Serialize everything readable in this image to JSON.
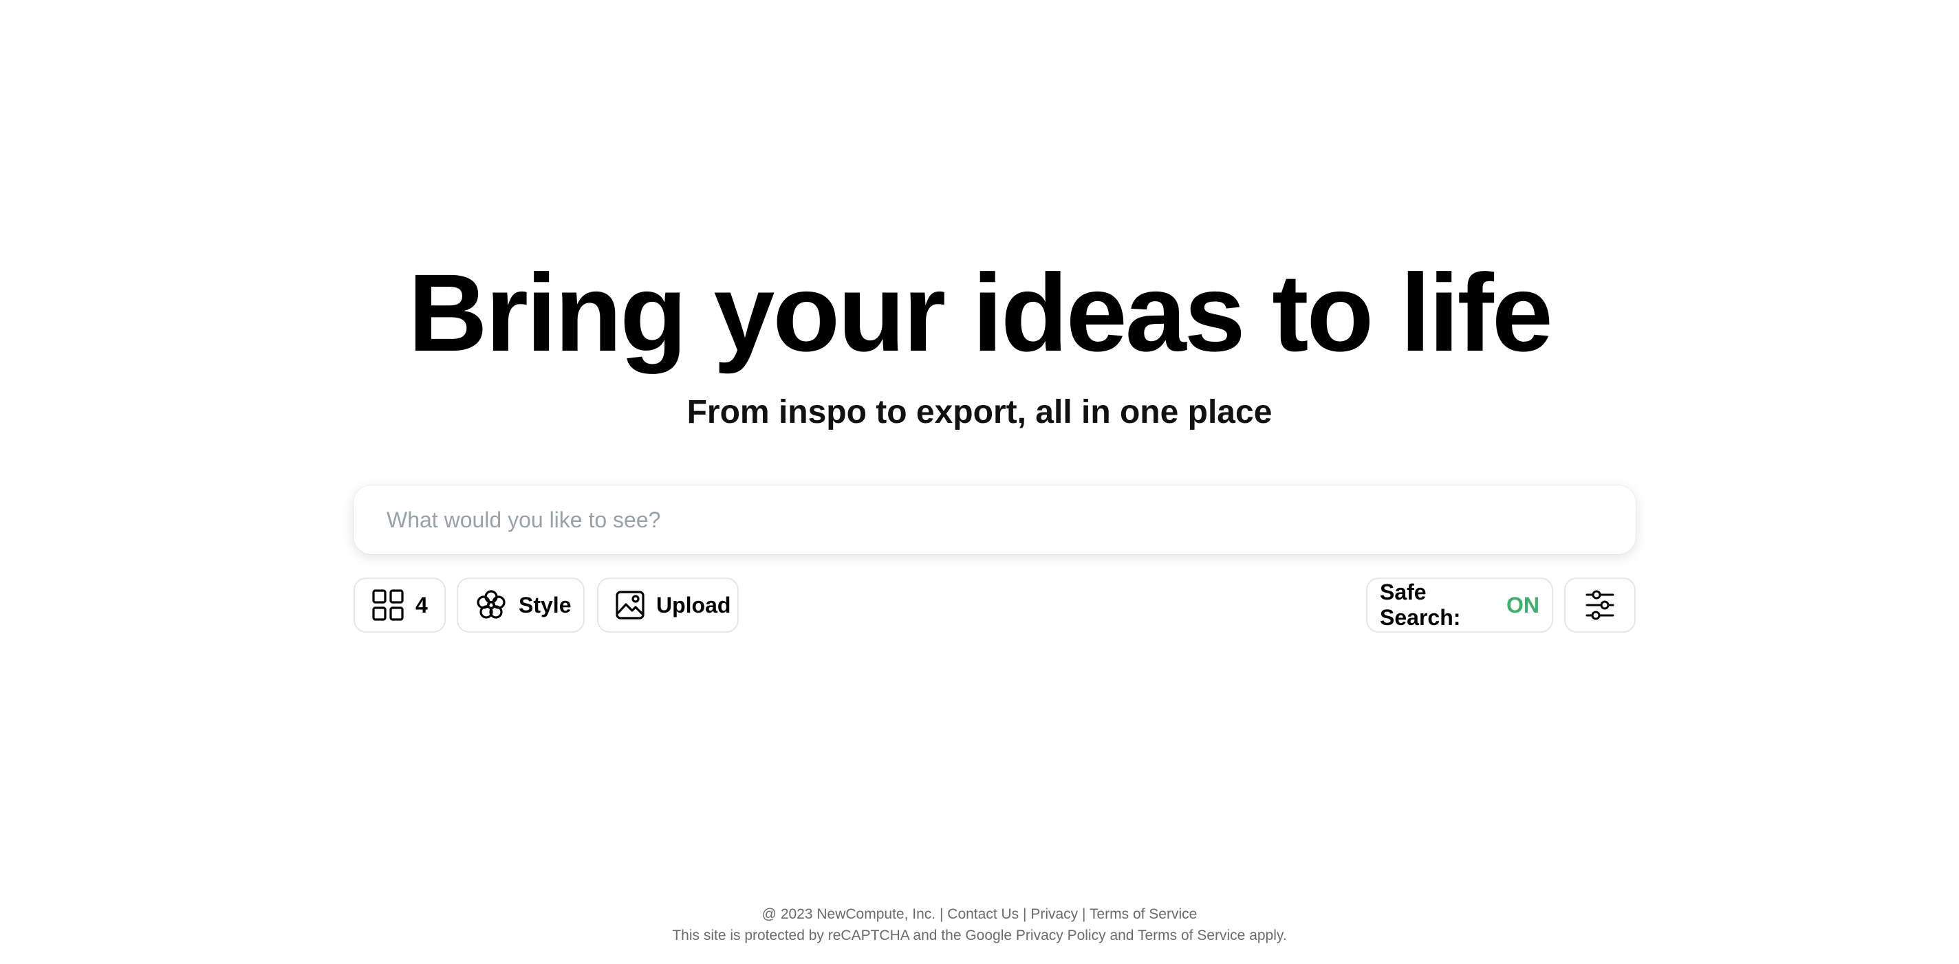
{
  "hero": {
    "title": "Bring your ideas to life",
    "subtitle": "From inspo to export, all in one place"
  },
  "search": {
    "placeholder": "What would you like to see?",
    "value": ""
  },
  "toolbar": {
    "count_label": "4",
    "count_icon": "grid-icon",
    "style_label": "Style",
    "style_icon": "flower-icon",
    "upload_label": "Upload",
    "upload_icon": "image-icon",
    "safe_search_label": "Safe Search:",
    "safe_search_value": "ON",
    "settings_icon": "sliders-icon"
  },
  "footer": {
    "copyright": "@ 2023 NewCompute, Inc.",
    "sep": "|",
    "contact": "Contact Us",
    "privacy": "Privacy",
    "terms": "Terms of Service",
    "recaptcha_prefix": "This site is protected by reCAPTCHA and the Google",
    "google_privacy": "Privacy Policy",
    "and": "and",
    "google_terms": "Terms of Service",
    "apply": "apply."
  },
  "colors": {
    "safe_on": "#3db06b",
    "text": "#000000",
    "muted": "#6b6b6b",
    "placeholder": "#9aa0a6"
  }
}
